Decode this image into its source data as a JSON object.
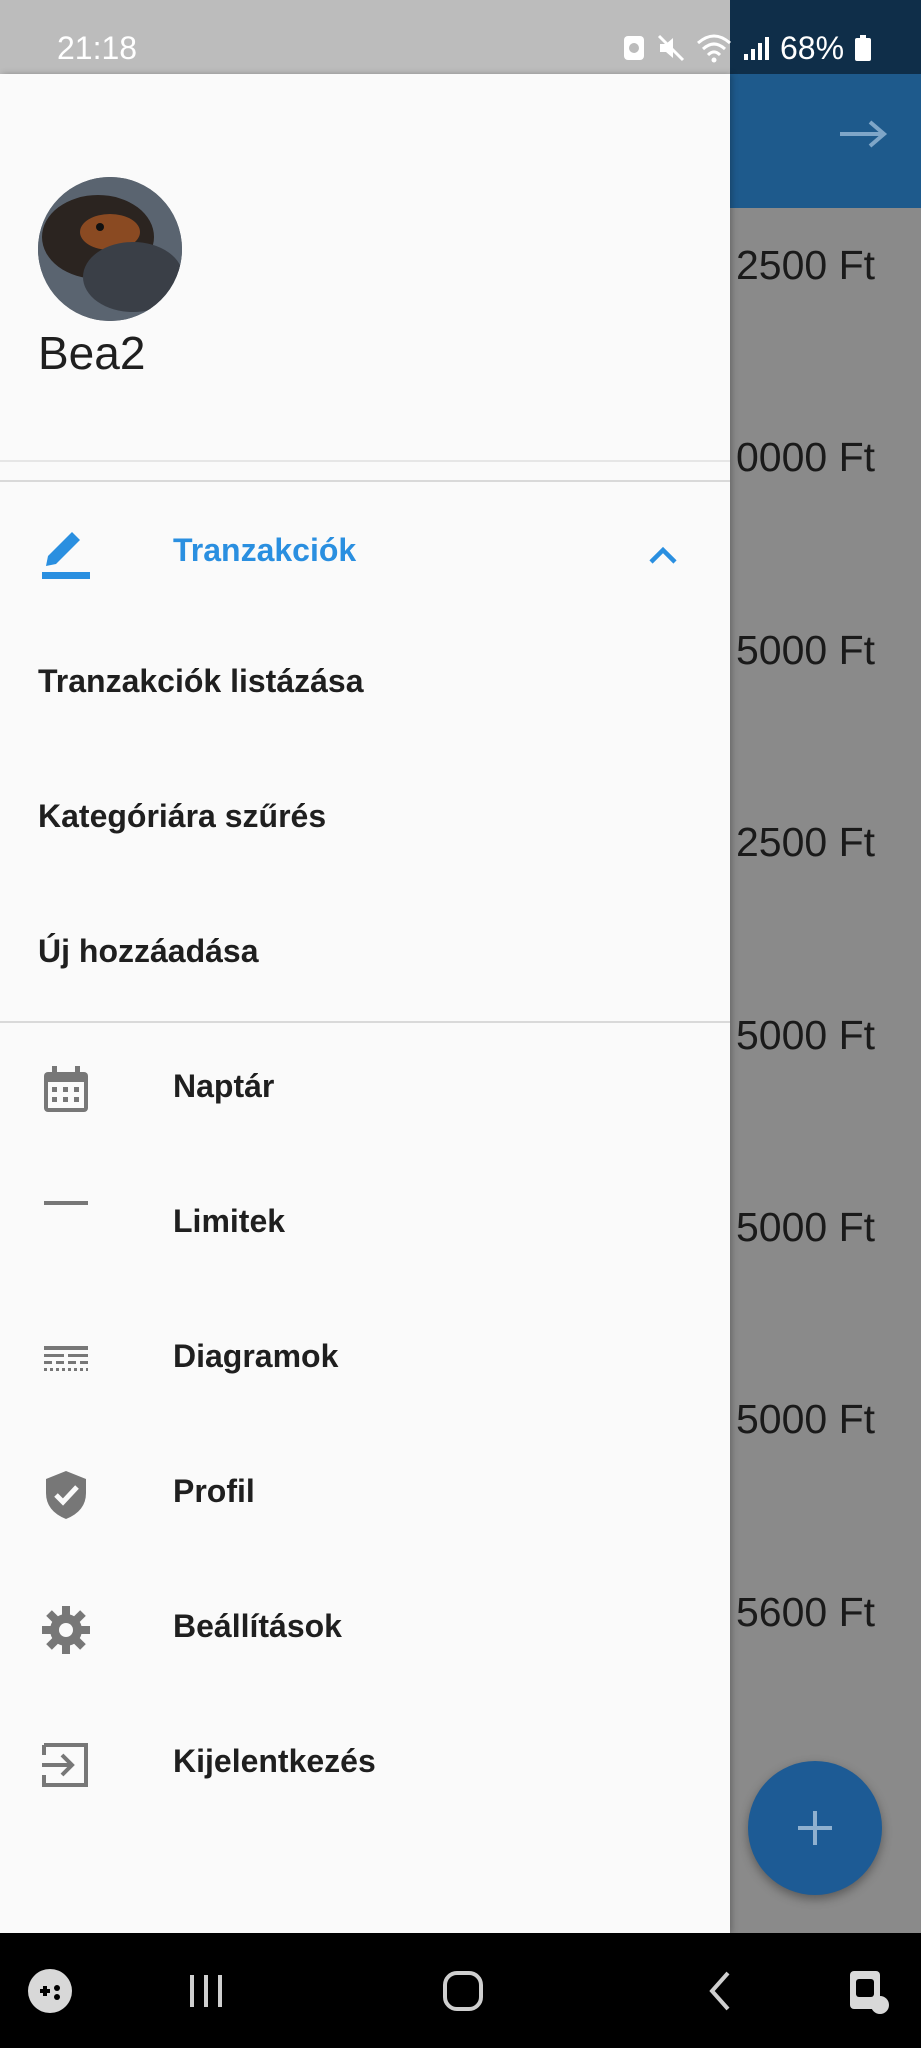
{
  "status_bar": {
    "time": "21:18",
    "battery": "68%",
    "icons": [
      "screenshot-icon",
      "mute-icon",
      "wifi-icon",
      "signal-icon",
      "battery-icon"
    ]
  },
  "drawer": {
    "user": {
      "name": "Bea2"
    },
    "expanded_section": {
      "label": "Tranzakciók",
      "icon": "edit-icon",
      "children": [
        {
          "label": "Tranzakciók listázása"
        },
        {
          "label": "Kategóriára szűrés"
        },
        {
          "label": "Új hozzáadása"
        }
      ]
    },
    "items": [
      {
        "label": "Naptár",
        "icon": "calendar-icon"
      },
      {
        "label": "Limitek",
        "icon": "minus-icon"
      },
      {
        "label": "Diagramok",
        "icon": "lines-icon"
      },
      {
        "label": "Profil",
        "icon": "shield-check-icon"
      },
      {
        "label": "Beállítások",
        "icon": "gear-icon"
      },
      {
        "label": "Kijelentkezés",
        "icon": "login-icon"
      }
    ],
    "accent_color": "#2a8fe0"
  },
  "background_app": {
    "header_color": "#1e5a8c",
    "amounts": [
      "2500 Ft",
      "0000 Ft",
      "5000 Ft",
      "2500 Ft",
      "5000 Ft",
      "5000 Ft",
      "5000 Ft",
      "5600 Ft"
    ],
    "fab_icon": "plus-icon"
  },
  "nav_bar": {
    "items": [
      "game-launcher-icon",
      "recents-icon",
      "home-icon",
      "back-icon",
      "accessibility-icon"
    ]
  }
}
